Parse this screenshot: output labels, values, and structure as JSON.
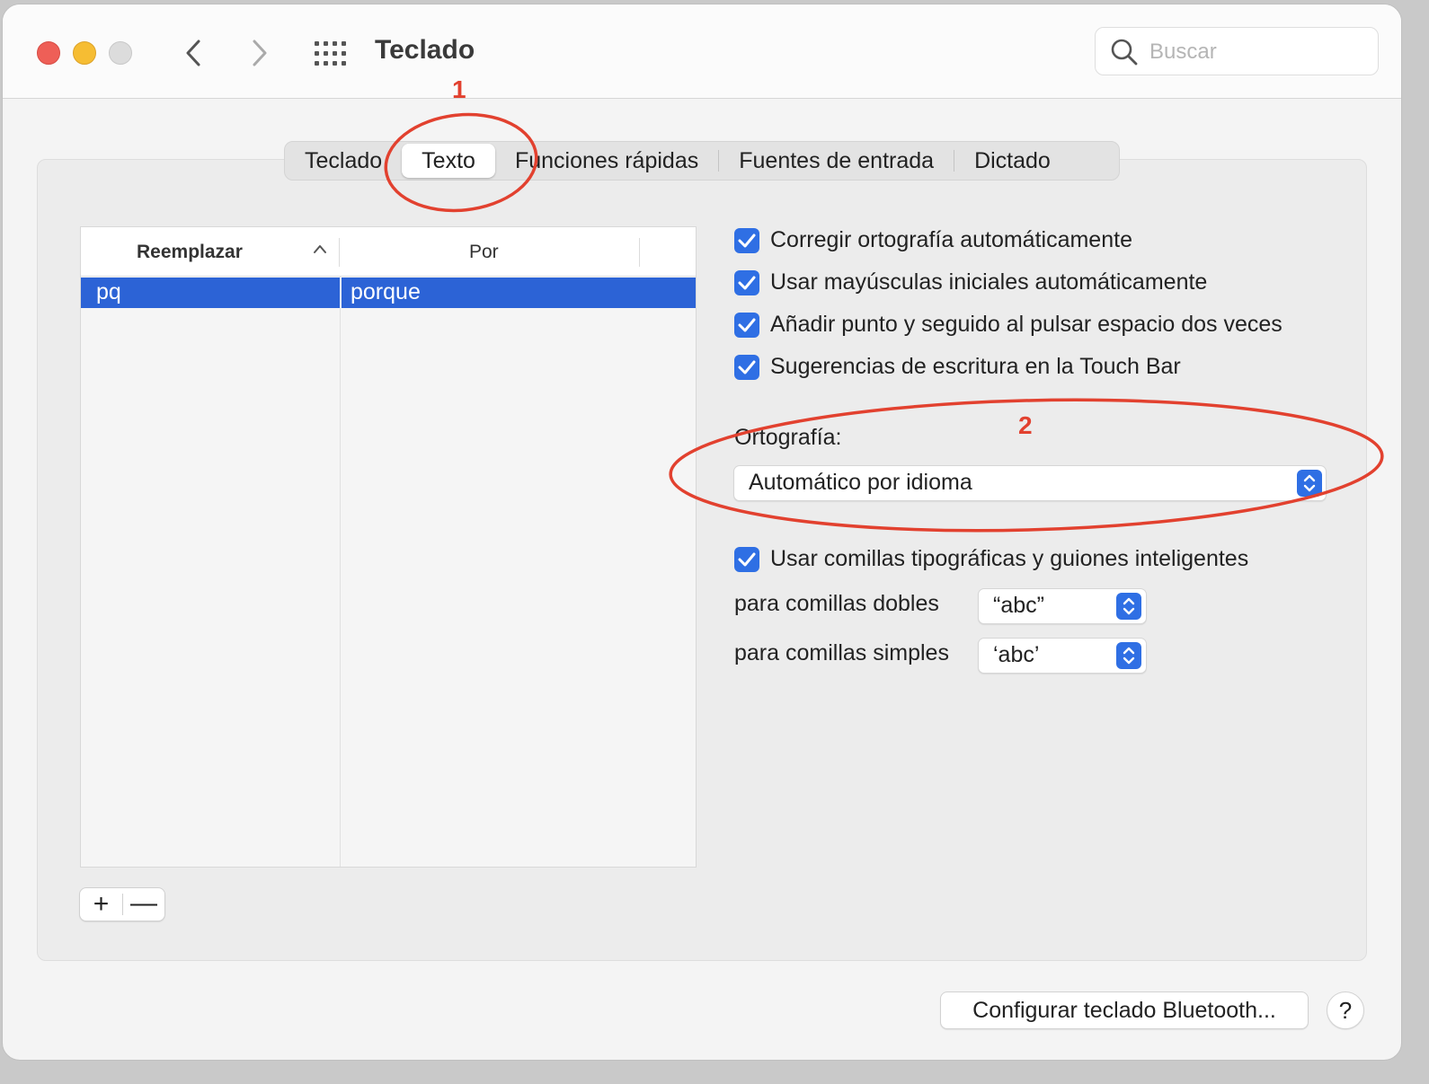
{
  "window": {
    "title": "Teclado",
    "search_placeholder": "Buscar"
  },
  "tabs": [
    {
      "label": "Teclado",
      "active": false
    },
    {
      "label": "Texto",
      "active": true
    },
    {
      "label": "Funciones rápidas",
      "active": false
    },
    {
      "label": "Fuentes de entrada",
      "active": false
    },
    {
      "label": "Dictado",
      "active": false
    }
  ],
  "replacements_table": {
    "col_replace": "Reemplazar",
    "col_with": "Por",
    "rows": [
      {
        "replace": "pq",
        "with": "porque",
        "selected": true
      }
    ],
    "add_label": "+",
    "remove_label": "—"
  },
  "options": [
    {
      "label": "Corregir ortografía automáticamente",
      "checked": true
    },
    {
      "label": "Usar mayúsculas iniciales automáticamente",
      "checked": true
    },
    {
      "label": "Añadir punto y seguido al pulsar espacio dos veces",
      "checked": true
    },
    {
      "label": "Sugerencias de escritura en la Touch Bar",
      "checked": true
    }
  ],
  "spelling": {
    "label": "Ortografía:",
    "value": "Automático por idioma"
  },
  "smart_quotes": {
    "label": "Usar comillas tipográficas y guiones inteligentes",
    "checked": true,
    "double_label": "para comillas dobles",
    "double_value": "“abc”",
    "single_label": "para comillas simples",
    "single_value": "‘abc’"
  },
  "footer": {
    "bluetooth_button": "Configurar teclado Bluetooth...",
    "help_button": "?"
  },
  "annotations": {
    "mark_1": "1",
    "mark_2": "2",
    "color": "#e2412f"
  },
  "colors": {
    "accent": "#2f6fe4",
    "selection": "#2c63d6"
  }
}
